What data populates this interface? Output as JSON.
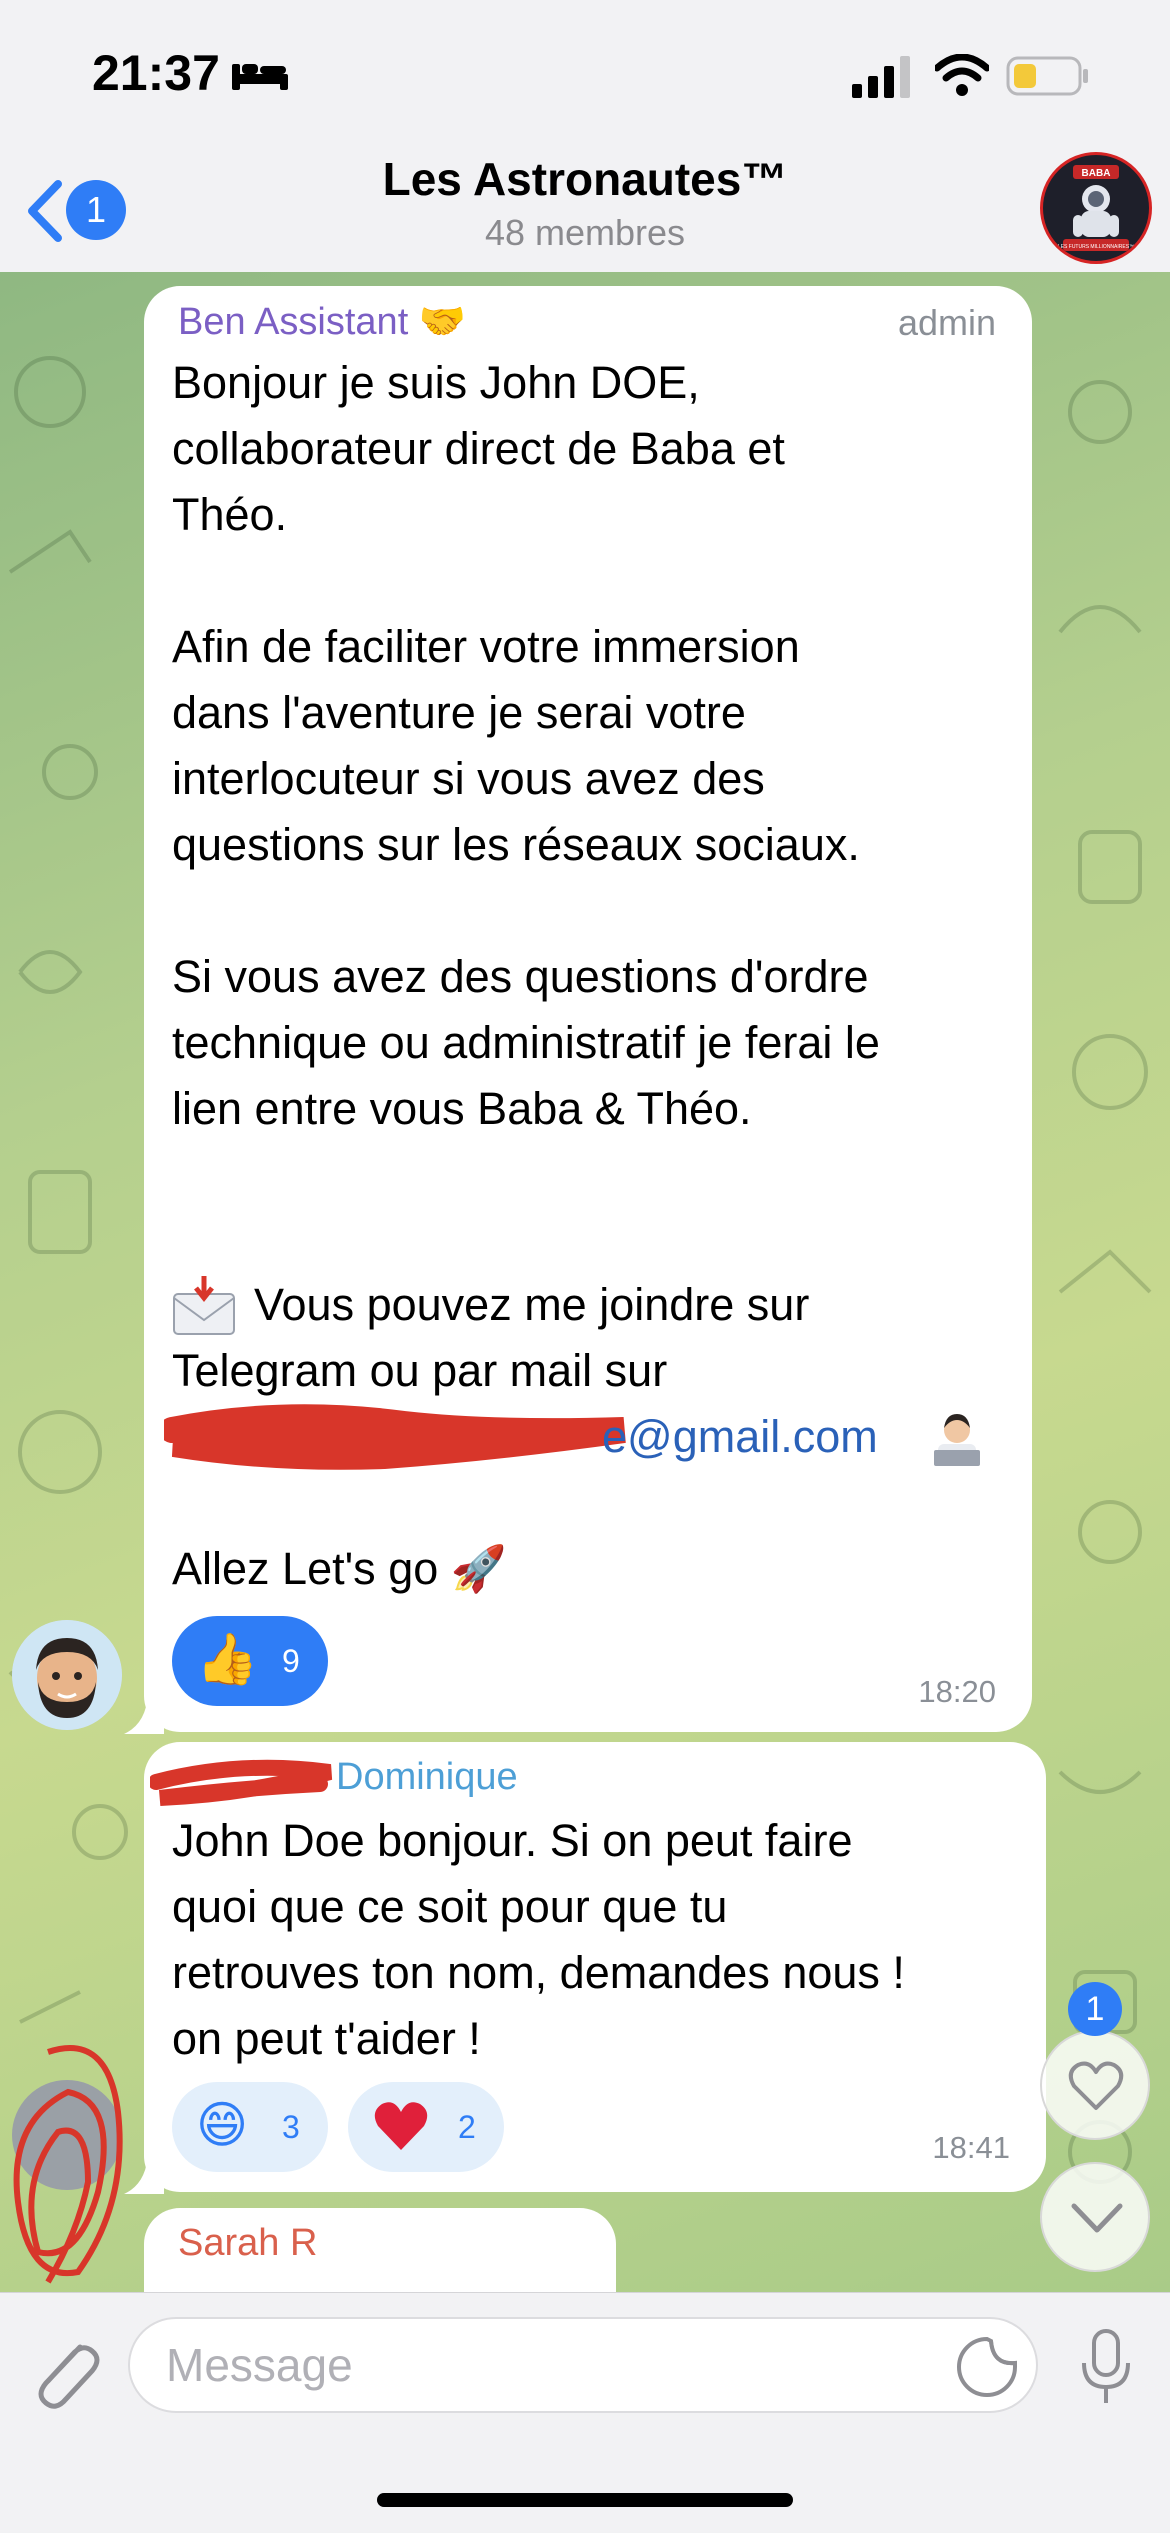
{
  "status_bar": {
    "time": "21:37"
  },
  "header": {
    "back_badge": "1",
    "title": "Les Astronautes™",
    "subtitle": "48 membres",
    "avatar_text_top": "BABA",
    "avatar_text_bottom": "LES FUTURS MILLIONNAIRES™"
  },
  "messages": [
    {
      "sender": "Ben Assistant 🤝",
      "role": "admin",
      "text": "Bonjour je suis John DOE,\ncollaborateur direct de Baba et\nThéo.\n\nAfin de faciliter votre immersion\ndans l'aventure je serai votre\ninterlocuteur si vous avez des\nquestions sur les réseaux sociaux.\n\nSi vous avez des questions d'ordre\ntechnique ou administratif je ferai le\nlien entre vous Baba & Théo.",
      "mail_intro": "Vous pouvez me joindre sur\nTelegram ou par mail sur",
      "email_visible": "e@gmail.com",
      "outro": "Allez Let's go 🚀",
      "reactions": [
        {
          "emoji": "👍",
          "count": "9"
        }
      ],
      "time": "18:20"
    },
    {
      "sender": "Dominique",
      "text": "John Doe bonjour. Si on peut faire\nquoi que ce soit pour que tu\nretrouves ton nom, demandes nous !\non peut t'aider !",
      "reactions": [
        {
          "emoji": "😄",
          "count": "3"
        },
        {
          "emoji": "❤️",
          "count": "2"
        }
      ],
      "time": "18:41"
    },
    {
      "sender": "Sarah R"
    }
  ],
  "floating": {
    "reaction_badge": "1"
  },
  "input": {
    "placeholder": "Message"
  },
  "colors": {
    "accent": "#2f7df6",
    "sender_ben": "#7b5fc4",
    "sender_dominique": "#4d9fd6",
    "sender_sarah": "#d9604c",
    "link": "#2a61b8",
    "redaction": "#d8362a"
  }
}
